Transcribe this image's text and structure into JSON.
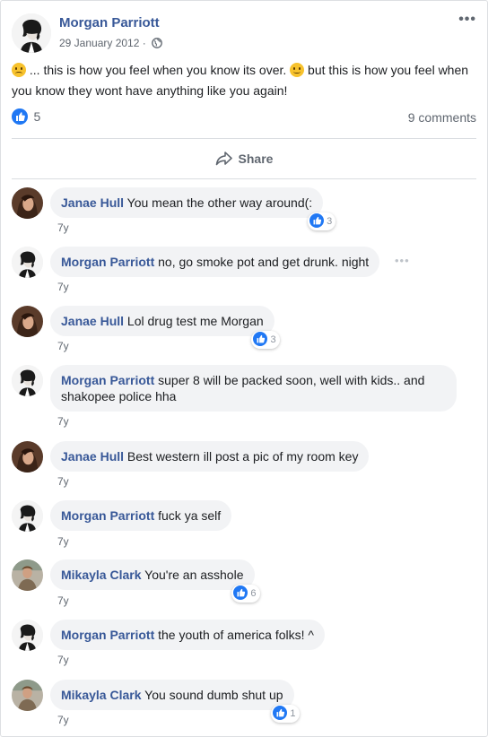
{
  "post": {
    "author": "Morgan Parriott",
    "date": "29 January 2012 ·",
    "text_part1": " ... this is how you feel when you know its over. ",
    "text_part2": " but this is how you feel when you know they wont have anything like you again!",
    "like_count": "5",
    "comment_count": "9 comments",
    "share_label": "Share"
  },
  "comments": [
    {
      "author": "Janae Hull",
      "text": "You mean the other way around(:",
      "time": "7y",
      "likes": "3"
    },
    {
      "author": "Morgan Parriott",
      "text": "no, go smoke pot and get drunk. night",
      "time": "7y"
    },
    {
      "author": "Janae Hull",
      "text": "Lol drug test me Morgan",
      "time": "7y",
      "likes": "3"
    },
    {
      "author": "Morgan Parriott",
      "text": "super 8 will be packed soon, well with kids.. and shakopee police hha",
      "time": "7y"
    },
    {
      "author": "Janae Hull",
      "text": "Best western ill post a pic of my room key",
      "time": "7y"
    },
    {
      "author": "Morgan Parriott",
      "text": "fuck ya self",
      "time": "7y"
    },
    {
      "author": "Mikayla Clark",
      "text": "You're an asshole",
      "time": "7y",
      "likes": "6"
    },
    {
      "author": "Morgan Parriott",
      "text": "the youth of america folks! ^",
      "time": "7y"
    },
    {
      "author": "Mikayla Clark",
      "text": "You sound dumb shut up",
      "time": "7y",
      "likes": "1"
    }
  ],
  "colors": {
    "link_blue": "#385898",
    "like_blue": "#2078f4",
    "bubble_bg": "#f2f3f5"
  }
}
